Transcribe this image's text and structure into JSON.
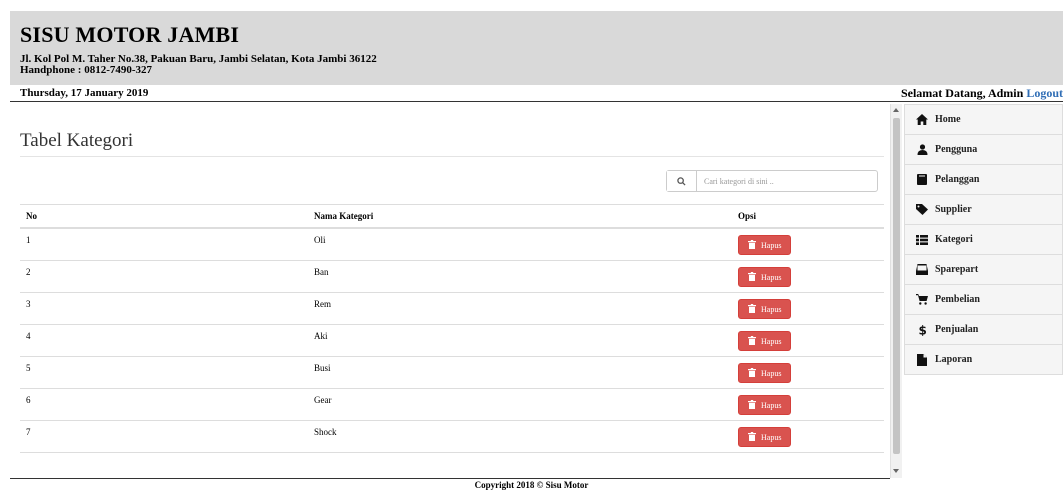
{
  "header": {
    "brand": "SISU MOTOR JAMBI",
    "address": "Jl. Kol Pol M. Taher No.38, Pakuan Baru, Jambi Selatan, Kota Jambi 36122",
    "phone": "Handphone : 0812-7490-327"
  },
  "topbar": {
    "date": "Thursday, 17 January 2019",
    "welcome": "Selamat Datang, Admin",
    "logout": "Logout"
  },
  "main": {
    "title": "Tabel Kategori",
    "search_placeholder": "Cari kategori di sini ..",
    "columns": [
      "No",
      "Nama Kategori",
      "Opsi"
    ],
    "delete_label": "Hapus",
    "rows": [
      {
        "no": "1",
        "nama": "Oli"
      },
      {
        "no": "2",
        "nama": "Ban"
      },
      {
        "no": "3",
        "nama": "Rem"
      },
      {
        "no": "4",
        "nama": "Aki"
      },
      {
        "no": "5",
        "nama": "Busi"
      },
      {
        "no": "6",
        "nama": "Gear"
      },
      {
        "no": "7",
        "nama": "Shock"
      }
    ]
  },
  "sidebar": {
    "items": [
      {
        "label": "Home",
        "icon": "home-icon"
      },
      {
        "label": "Pengguna",
        "icon": "user-icon"
      },
      {
        "label": "Pelanggan",
        "icon": "book-icon"
      },
      {
        "label": "Supplier",
        "icon": "tag-icon"
      },
      {
        "label": "Kategori",
        "icon": "list-icon"
      },
      {
        "label": "Sparepart",
        "icon": "hdd-icon"
      },
      {
        "label": "Pembelian",
        "icon": "cart-icon"
      },
      {
        "label": "Penjualan",
        "icon": "dollar-icon"
      },
      {
        "label": "Laporan",
        "icon": "file-icon"
      }
    ]
  },
  "footer": {
    "copyright": "Copyright 2018 © Sisu Motor"
  },
  "colors": {
    "header_bg": "#d9d9d9",
    "danger": "#d9534f",
    "link": "#2f6db5",
    "sidebar_bg": "#f5f5f5"
  }
}
